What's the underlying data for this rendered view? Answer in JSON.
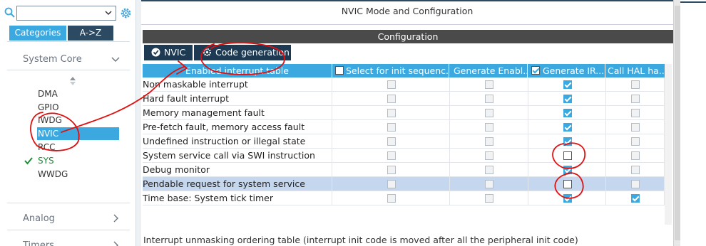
{
  "left_panel": {
    "search": {
      "value": "",
      "placeholder": ""
    },
    "tabs": [
      {
        "label": "Categories"
      },
      {
        "label": "A->Z"
      }
    ],
    "categories": [
      {
        "label": "System Core",
        "expanded": true
      },
      {
        "label": "Analog",
        "expanded": false
      },
      {
        "label": "Timers",
        "expanded": false
      }
    ],
    "system_core_items": [
      {
        "label": "DMA"
      },
      {
        "label": "GPIO"
      },
      {
        "label": "IWDG"
      },
      {
        "label": "NVIC",
        "selected": true
      },
      {
        "label": "RCC"
      },
      {
        "label": "SYS",
        "status": "ok"
      },
      {
        "label": "WWDG"
      }
    ]
  },
  "main": {
    "mode_title": "NVIC Mode and Configuration",
    "config_title": "Configuration",
    "subtabs": [
      {
        "label": "NVIC"
      },
      {
        "label": "Code generation"
      }
    ],
    "table": {
      "headers": [
        "Enabled interrupt table",
        "Select for init sequenc...",
        "Generate Enabl...",
        "Generate IR...",
        "Call HAL ha..."
      ],
      "header_checks": [
        false,
        true
      ],
      "rows": [
        {
          "name": "Non maskable interrupt",
          "cols": [
            false,
            false,
            true,
            false
          ]
        },
        {
          "name": "Hard fault interrupt",
          "cols": [
            false,
            false,
            true,
            false
          ]
        },
        {
          "name": "Memory management fault",
          "cols": [
            false,
            false,
            true,
            false
          ]
        },
        {
          "name": "Pre-fetch fault, memory access fault",
          "cols": [
            false,
            false,
            true,
            false
          ]
        },
        {
          "name": "Undefined instruction or illegal state",
          "cols": [
            false,
            false,
            true,
            false
          ]
        },
        {
          "name": "System service call via SWI instruction",
          "cols": [
            false,
            false,
            false,
            false
          ],
          "generate_irq_unchecked_white": true
        },
        {
          "name": "Debug monitor",
          "cols": [
            false,
            false,
            true,
            false
          ]
        },
        {
          "name": "Pendable request for system service",
          "cols": [
            false,
            false,
            false,
            false
          ],
          "highlighted": true,
          "generate_irq_unchecked_white": true
        },
        {
          "name": "Time base: System tick timer",
          "cols": [
            false,
            false,
            true,
            true
          ]
        }
      ]
    },
    "footer_text": "Interrupt unmasking ordering table (interrupt init code is moved after all the peripheral init code)"
  },
  "colors": {
    "accent": "#3ca8e0",
    "dark_tab": "#1e3a52",
    "config_bar": "#4a4a4a",
    "highlight_row": "#c5d7ee",
    "ok_green": "#1f8a3c",
    "annotation_red": "#e01010"
  },
  "icons": {
    "search": "search-icon",
    "dropdown": "chevron-down-icon",
    "settings": "gear-icon",
    "sort": "sort-icon",
    "check": "check-icon",
    "nvic_tab": "check-circle-icon",
    "code_tab": "gear-icon"
  }
}
